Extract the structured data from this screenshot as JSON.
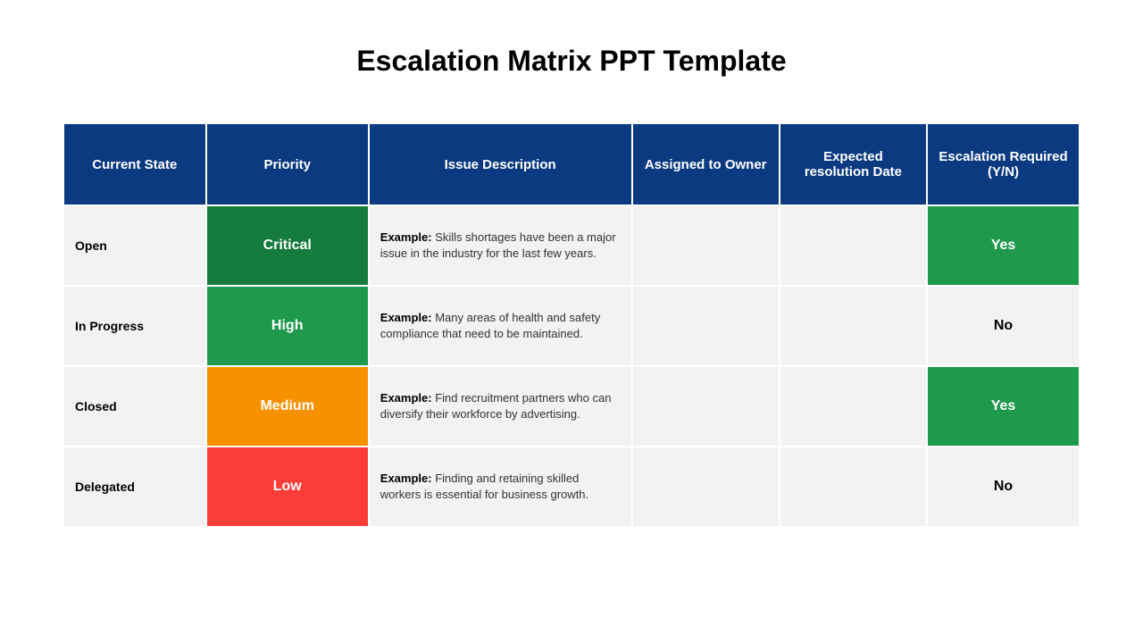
{
  "title": "Escalation Matrix PPT Template",
  "colors": {
    "header": "#0b3a80",
    "cell": "#f2f2f2",
    "critical": "#157b3e",
    "high": "#1f9a4c",
    "medium": "#f79100",
    "low": "#fb3d3a",
    "yes": "#1f9a4c"
  },
  "headers": {
    "state": "Current State",
    "priority": "Priority",
    "issue": "Issue Description",
    "owner": "Assigned to Owner",
    "date": "Expected resolution Date",
    "escalation": "Escalation Required (Y/N)"
  },
  "rows": [
    {
      "state": "Open",
      "priority": "Critical",
      "priority_color": "#157b3e",
      "issue_lead": "Example:",
      "issue_text": " Skills shortages have been a major issue in the industry for the last few years.",
      "owner": "",
      "date": "",
      "escalation": "Yes",
      "escalation_color": "#1f9a4c",
      "escalation_class": "yes"
    },
    {
      "state": "In Progress",
      "priority": "High",
      "priority_color": "#1f9a4c",
      "issue_lead": "Example:",
      "issue_text": " Many areas of health and safety compliance that need to be maintained.",
      "owner": "",
      "date": "",
      "escalation": "No",
      "escalation_color": "#f2f2f2",
      "escalation_class": "no"
    },
    {
      "state": "Closed",
      "priority": "Medium",
      "priority_color": "#f79100",
      "issue_lead": "Example:",
      "issue_text": " Find recruitment partners who can diversify their workforce by advertising.",
      "owner": "",
      "date": "",
      "escalation": "Yes",
      "escalation_color": "#1f9a4c",
      "escalation_class": "yes"
    },
    {
      "state": "Delegated",
      "priority": "Low",
      "priority_color": "#fb3d3a",
      "issue_lead": "Example:",
      "issue_text": " Finding and retaining skilled workers is essential for business growth.",
      "owner": "",
      "date": "",
      "escalation": "No",
      "escalation_color": "#f2f2f2",
      "escalation_class": "no"
    }
  ]
}
